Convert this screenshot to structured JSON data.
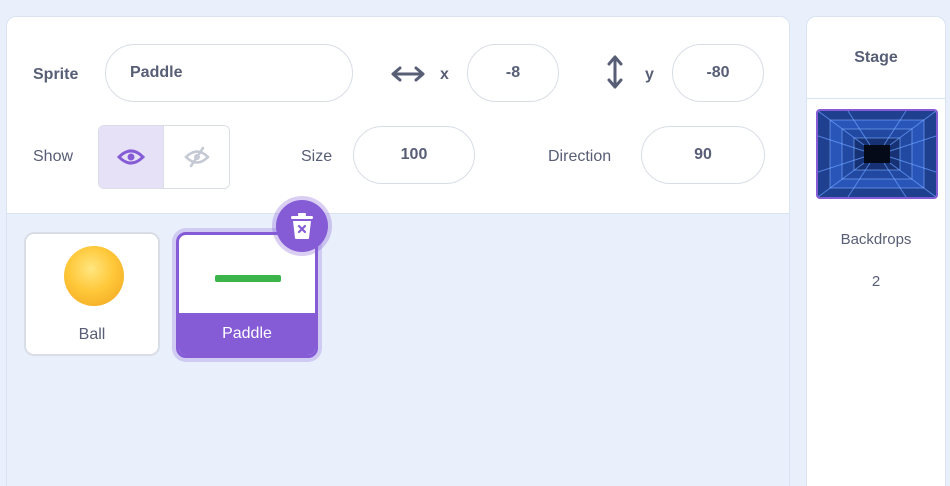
{
  "sprite_info": {
    "sprite_label": "Sprite",
    "sprite_name": "Paddle",
    "x_label": "x",
    "x_value": "-8",
    "y_label": "y",
    "y_value": "-80",
    "show_label": "Show",
    "size_label": "Size",
    "size_value": "100",
    "direction_label": "Direction",
    "direction_value": "90"
  },
  "sprites": [
    {
      "name": "Ball",
      "selected": false
    },
    {
      "name": "Paddle",
      "selected": true
    }
  ],
  "stage": {
    "title": "Stage",
    "backdrops_label": "Backdrops",
    "backdrops_count": "2"
  },
  "colors": {
    "accent": "#855cd6",
    "text": "#575e75",
    "background": "#e9f0fb",
    "paddle": "#3bb54a"
  }
}
